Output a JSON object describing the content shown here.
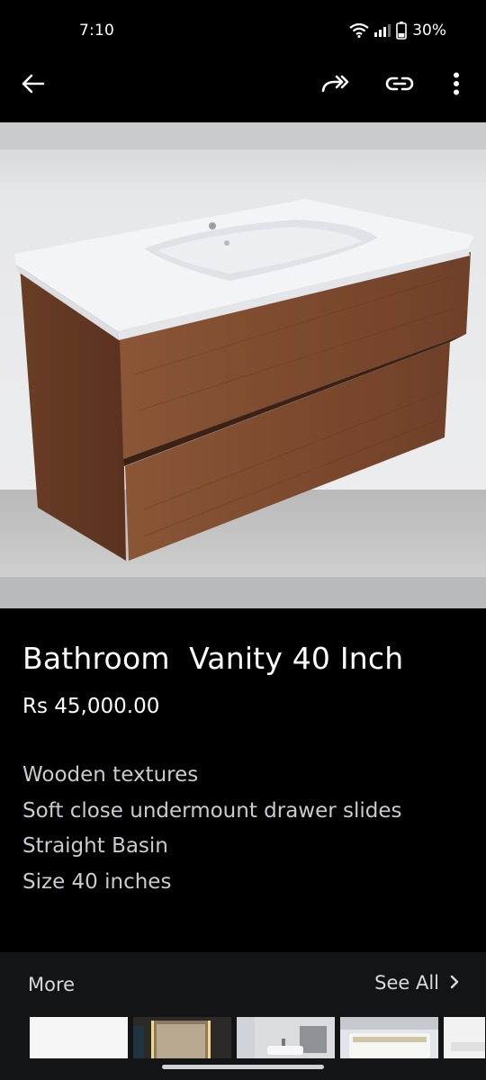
{
  "status_bar": {
    "time": "7:10",
    "battery": "30%",
    "battery_level": 0.3
  },
  "app_bar": {
    "back_icon": "arrow-left-icon",
    "share_icon": "forward-share-icon",
    "link_icon": "link-icon",
    "menu_icon": "more-vertical-icon"
  },
  "gallery": {
    "image_count": 3,
    "current_index": 1
  },
  "product": {
    "title": "Bathroom  Vanity 40 Inch",
    "price": "Rs 45,000.00",
    "description": [
      "Wooden textures",
      "Soft close undermount drawer slides",
      "Straight Basin",
      "Size 40 inches"
    ]
  },
  "more": {
    "label": "More",
    "see_all": "See All"
  },
  "colors": {
    "background": "#000000",
    "more_section": "#121416",
    "wood": "#7a4a30",
    "basin": "#f4f5f7"
  }
}
